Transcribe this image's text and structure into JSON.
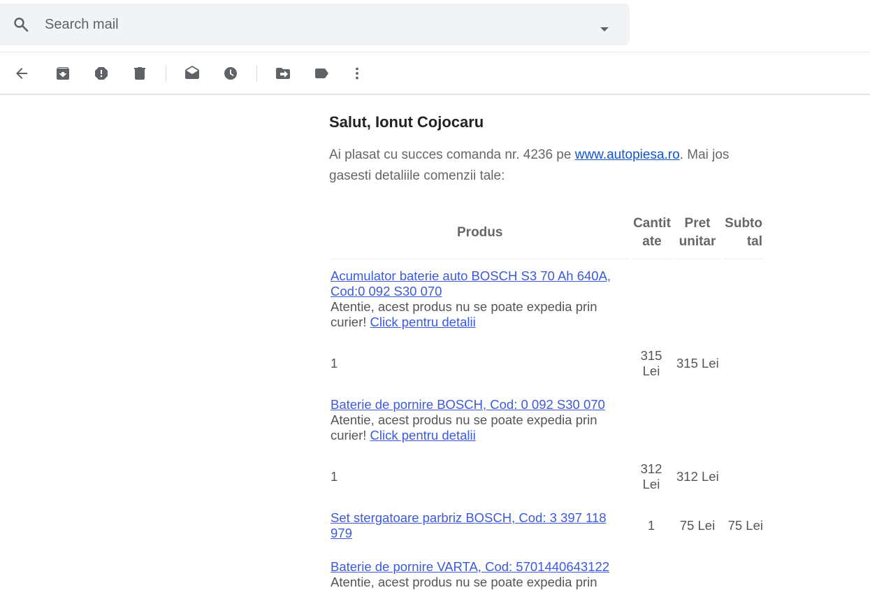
{
  "search": {
    "placeholder": "Search mail",
    "value": ""
  },
  "toolbar": {
    "buttons": [
      {
        "icon": "back-arrow-icon"
      },
      {
        "icon": "archive-icon"
      },
      {
        "icon": "report-spam-icon"
      },
      {
        "icon": "delete-icon"
      },
      {
        "icon": "mark-unread-icon"
      },
      {
        "icon": "snooze-icon"
      },
      {
        "icon": "move-to-icon"
      },
      {
        "icon": "label-icon"
      },
      {
        "icon": "more-vert-icon"
      }
    ]
  },
  "email": {
    "greeting": "Salut, Ionut Cojocaru",
    "intro_before": "Ai plasat cu succes comanda nr. 4236 pe ",
    "intro_link": "www.autopiesa.ro",
    "intro_after": ". Mai jos gasesti detaliile comenzii tale:",
    "table": {
      "headers": {
        "product": "Produs",
        "qty_line1": "Cantit",
        "qty_line2": "ate",
        "price_line1": "Pret",
        "price_line2": "unitar",
        "subtotal_line1": "Subto",
        "subtotal_line2": "tal"
      },
      "items": [
        {
          "link_line1": "Acumulator baterie auto BOSCH S3 70 Ah 640A,",
          "link_line2": "Cod:0 092 S30 070",
          "note_line1": "Atentie, acest produs nu se poate expedia prin",
          "note_prefix": "curier! ",
          "note_link": "Click pentru detalii",
          "qty": "1",
          "price_line1": "315",
          "price_line2": "Lei",
          "subtotal": "315 Lei"
        },
        {
          "link_line1": "Baterie de pornire BOSCH, Cod: 0 092 S30 070",
          "note_line1": "Atentie, acest produs nu se poate expedia prin",
          "note_prefix": "curier! ",
          "note_link": "Click pentru detalii",
          "qty": "1",
          "price_line1": "312",
          "price_line2": "Lei",
          "subtotal": "312 Lei"
        },
        {
          "link_line1": "Set stergatoare parbriz BOSCH, Cod: 3 397 118",
          "link_line2": "979",
          "qty": "1",
          "price": "75 Lei",
          "subtotal": "75 Lei"
        },
        {
          "link_line1": "Baterie de pornire VARTA, Cod: 5701440643122",
          "note_line1": "Atentie, acest produs nu se poate expedia prin"
        }
      ]
    }
  },
  "colors": {
    "link": "#3c5bd8",
    "icon": "#5f6368",
    "search_bg": "#f1f3f4"
  }
}
